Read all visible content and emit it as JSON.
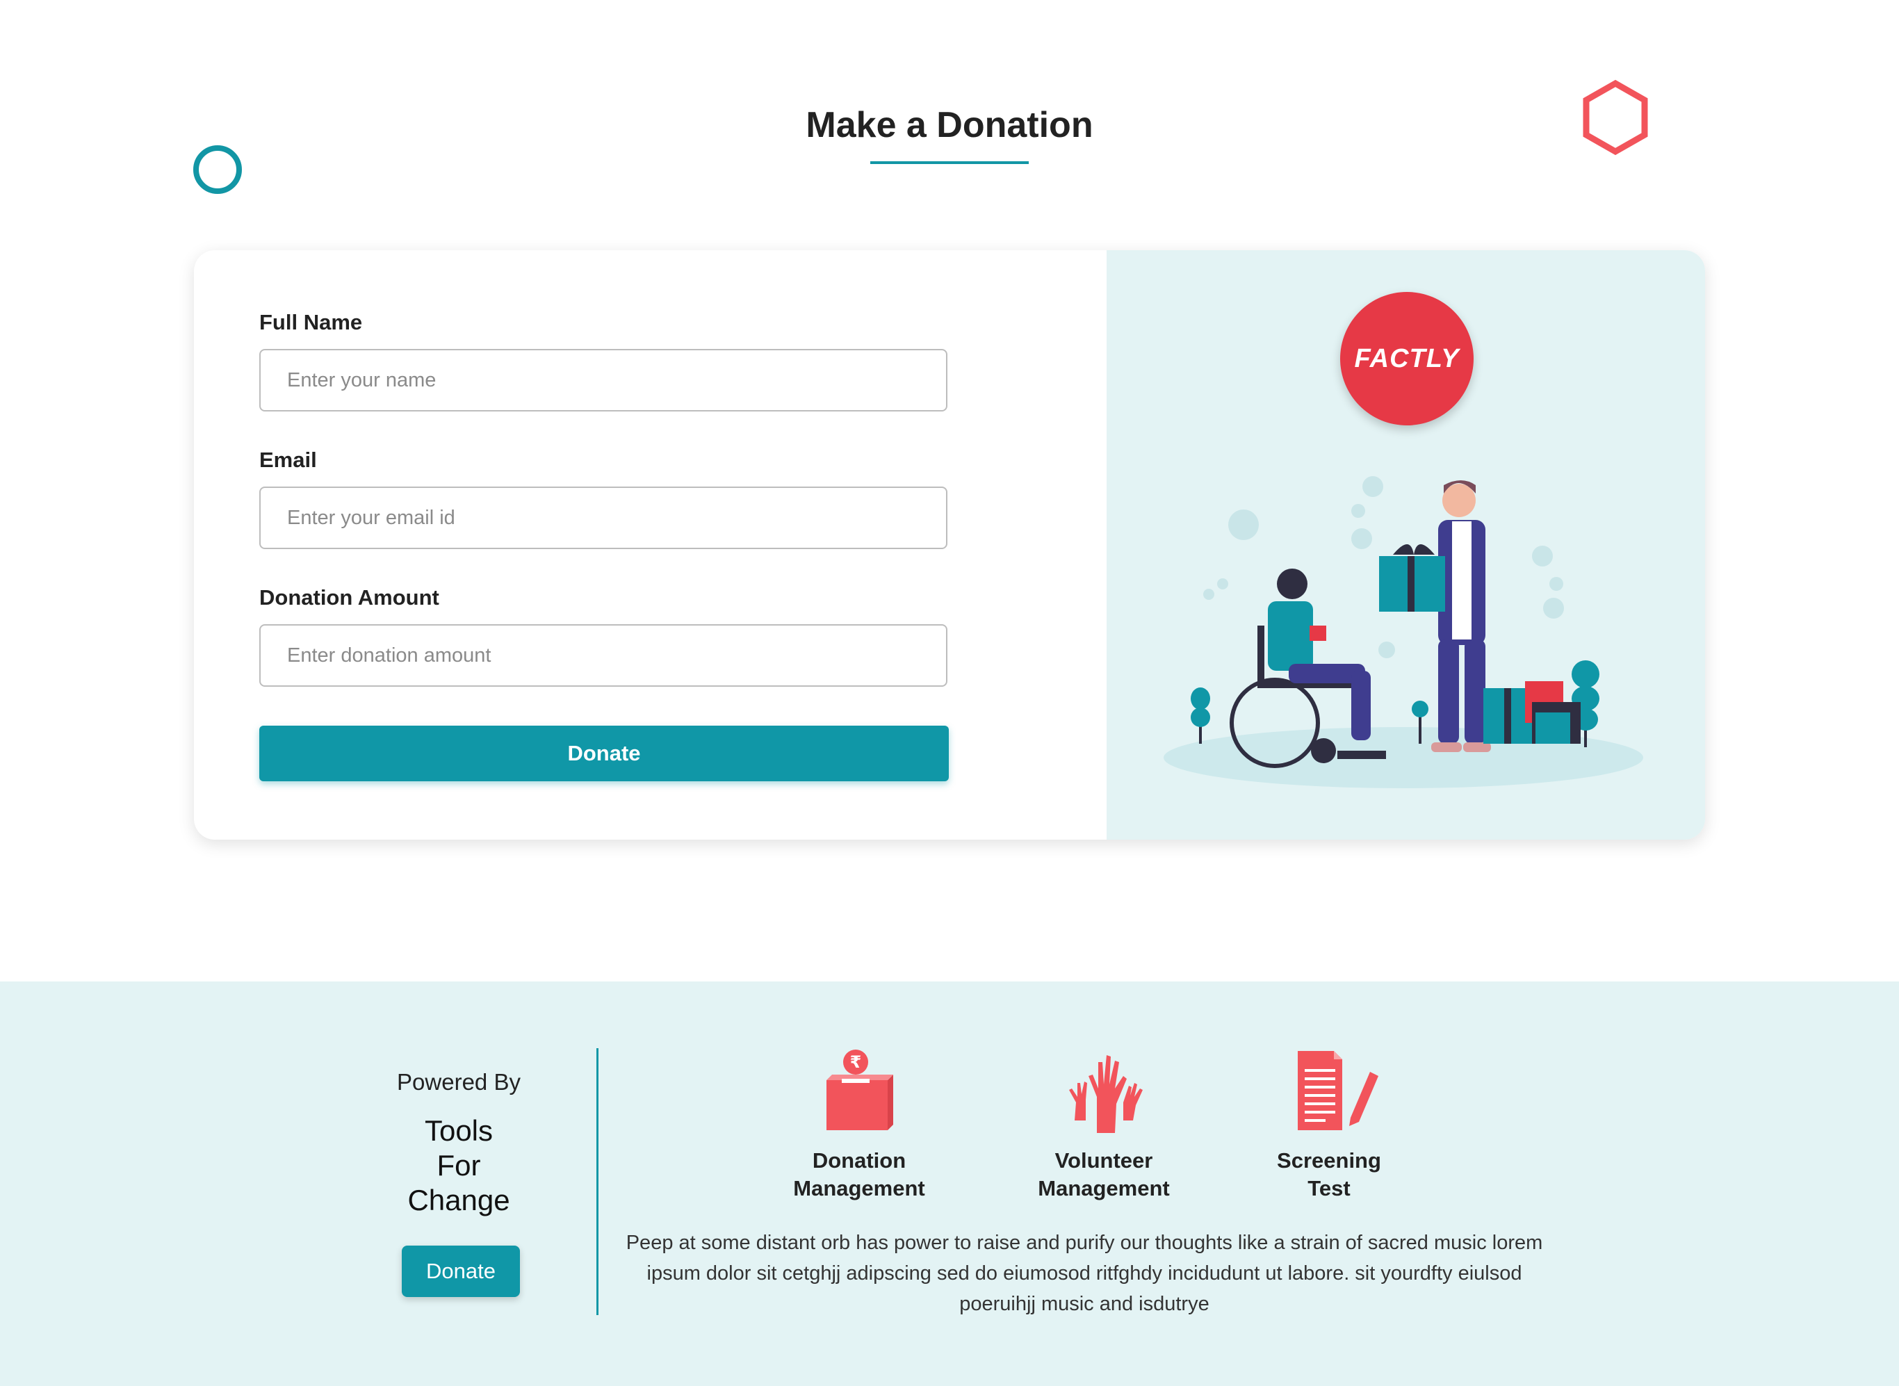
{
  "page": {
    "title": "Make a Donation"
  },
  "form": {
    "full_name": {
      "label": "Full Name",
      "placeholder": "Enter your name",
      "value": ""
    },
    "email": {
      "label": "Email",
      "placeholder": "Enter your email id",
      "value": ""
    },
    "amount": {
      "label": "Donation Amount",
      "placeholder": "Enter donation amount",
      "value": ""
    },
    "submit_label": "Donate"
  },
  "brand": {
    "logo_text": "FACTLY",
    "logo_color": "#e63946"
  },
  "colors": {
    "accent": "#1097a7",
    "coral": "#f2545b",
    "panel": "#e3f3f4"
  },
  "footer": {
    "powered_by": "Powered By",
    "org_name": "Tools\nFor\nChange",
    "donate_label": "Donate",
    "features": [
      {
        "icon": "donation-box-icon",
        "label": "Donation\nManagement"
      },
      {
        "icon": "raised-hands-icon",
        "label": "Volunteer\nManagement"
      },
      {
        "icon": "document-pencil-icon",
        "label": "Screening\nTest"
      }
    ],
    "description": "Peep at some distant orb has power to raise and purify our thoughts like a strain of sacred music lorem ipsum dolor sit  cetghjj adipscing sed do eiumosod ritfghdy incidudunt ut labore. sit yourdfty eiulsod poeruihjj  music and isdutrye"
  }
}
